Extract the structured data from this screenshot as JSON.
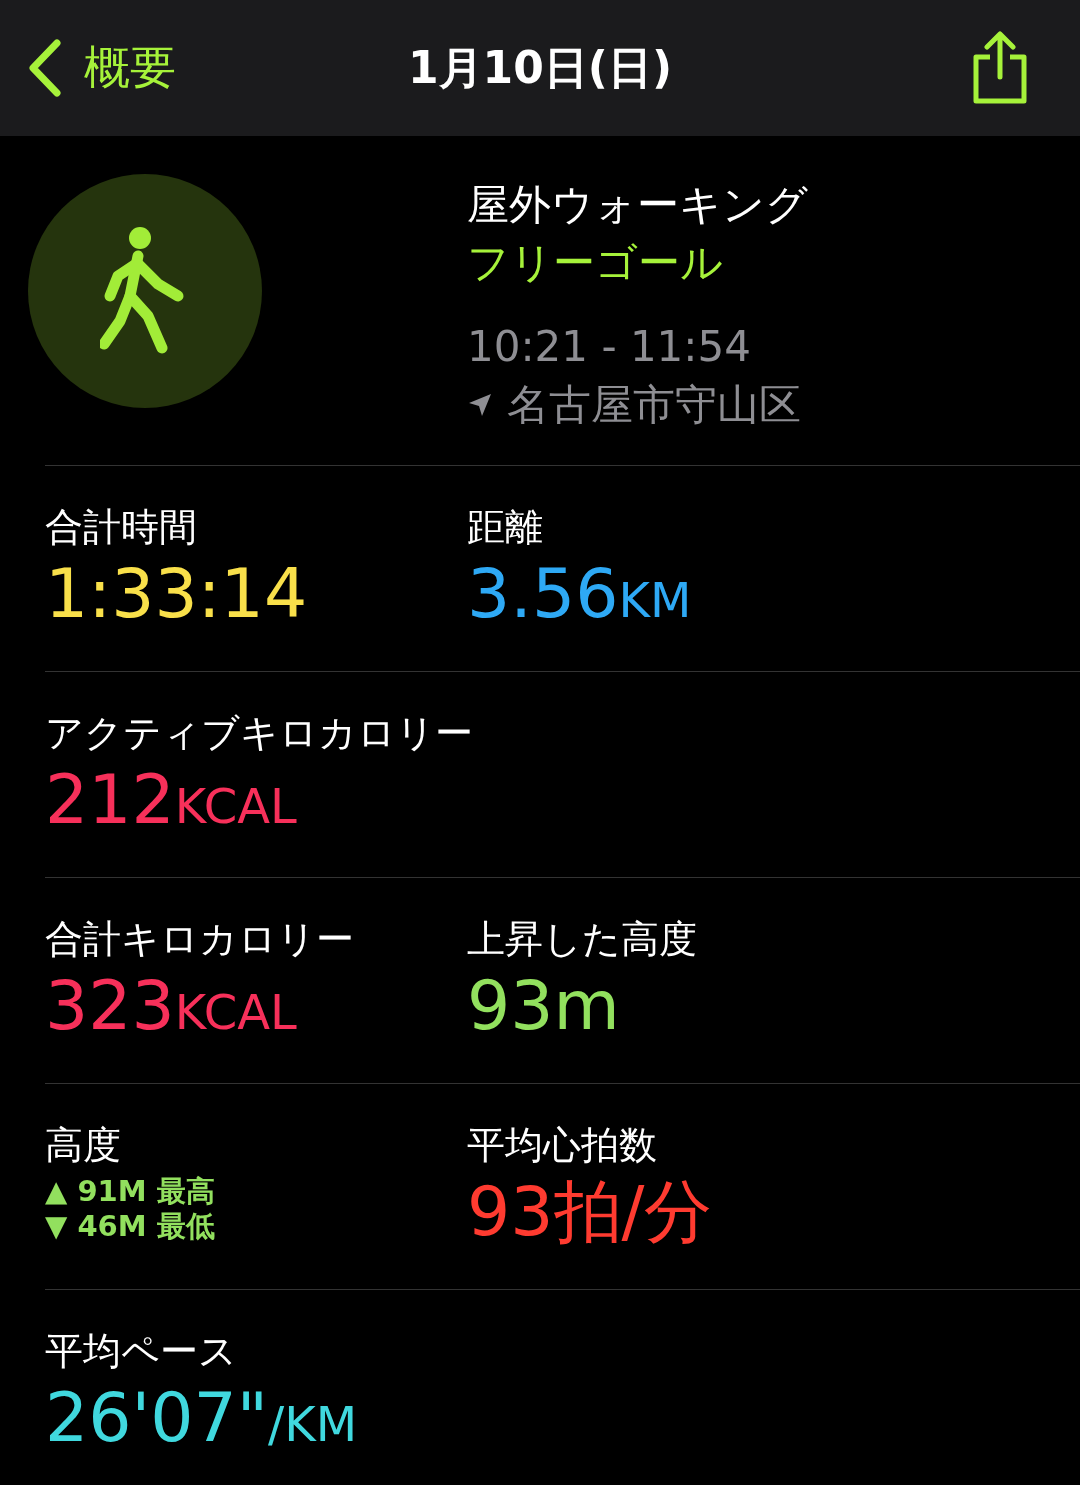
{
  "nav": {
    "back_label": "概要",
    "title": "1月10日(日)"
  },
  "workout": {
    "name": "屋外ウォーキング",
    "goal": "フリーゴール",
    "time": "10:21 - 11:54",
    "location": "名古屋市守山区"
  },
  "metrics": [
    {
      "cells": [
        {
          "kind": "value",
          "label": "合計時間",
          "value": "1:33:14",
          "color": "#f9e04a"
        },
        {
          "kind": "value",
          "label": "距離",
          "value": "3.56",
          "unit": "KM",
          "color": "#2ea9f5"
        }
      ]
    },
    {
      "cells": [
        {
          "kind": "value",
          "label": "アクティブキロカロリー",
          "value": "212",
          "unit": "KCAL",
          "color": "#f7305a"
        }
      ]
    },
    {
      "cells": [
        {
          "kind": "value",
          "label": "合計キロカロリー",
          "value": "323",
          "unit": "KCAL",
          "color": "#f7305a"
        },
        {
          "kind": "value",
          "label": "上昇した高度",
          "value": "93m",
          "color": "#92e05e"
        }
      ]
    },
    {
      "cells": [
        {
          "kind": "elevation",
          "label": "高度",
          "color": "#92e05e",
          "lines": [
            {
              "arrow": "▲",
              "text": "91M 最高"
            },
            {
              "arrow": "▼",
              "text": "46M 最低"
            }
          ]
        },
        {
          "kind": "value",
          "label": "平均心拍数",
          "value": "93拍/分",
          "color": "#ff3b30"
        }
      ]
    },
    {
      "cells": [
        {
          "kind": "value",
          "label": "平均ペース",
          "value": "26'07\"",
          "unit": "/KM",
          "color": "#40d8de"
        }
      ]
    }
  ]
}
